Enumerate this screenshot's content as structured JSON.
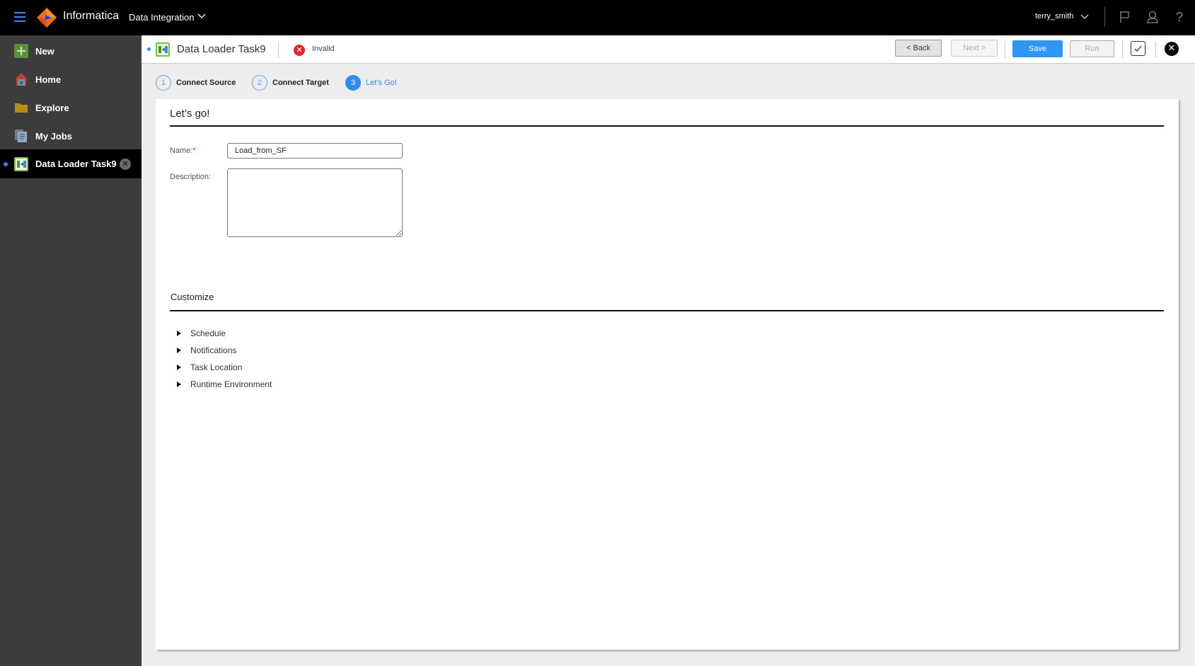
{
  "header": {
    "brand": "Informatica",
    "product": "Data Integration",
    "username": "terry_smith",
    "icons": [
      "menu-icon",
      "flag-icon",
      "user-icon",
      "help-icon"
    ]
  },
  "sidebar": {
    "items": [
      {
        "label": "New",
        "icon": "plus-icon"
      },
      {
        "label": "Home",
        "icon": "home-icon"
      },
      {
        "label": "Explore",
        "icon": "folder-icon"
      },
      {
        "label": "My Jobs",
        "icon": "jobs-icon"
      }
    ],
    "open_tab": {
      "label": "Data Loader Task9",
      "icon": "data-loader-icon"
    }
  },
  "taskbar": {
    "title": "Data Loader Task9",
    "status": "Invalid",
    "back_label": "< Back",
    "next_label": "Next >",
    "save_label": "Save",
    "run_label": "Run"
  },
  "steps": [
    {
      "num": "1",
      "label": "Connect Source"
    },
    {
      "num": "2",
      "label": "Connect Target"
    },
    {
      "num": "3",
      "label": "Let's Go!"
    }
  ],
  "form": {
    "title": "Let’s go!",
    "name_label": "Name:",
    "required_mark": "*",
    "name_value": "Load_from_SF",
    "description_label": "Description:",
    "description_value": ""
  },
  "customize": {
    "title": "Customize",
    "sections": [
      "Schedule",
      "Notifications",
      "Task Location",
      "Runtime Environment"
    ]
  },
  "colors": {
    "accent": "#2f8cf3",
    "save": "#2f96f3",
    "error": "#e0262a"
  }
}
